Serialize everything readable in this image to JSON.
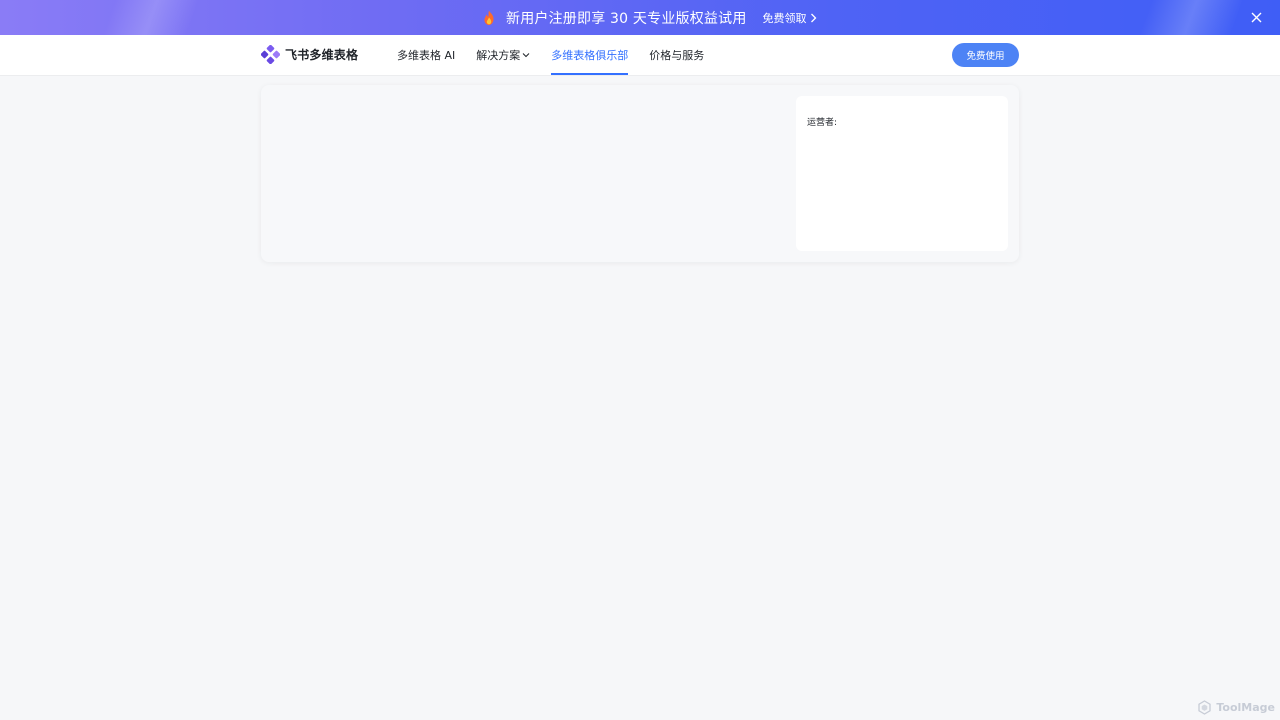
{
  "promo": {
    "icon": "fire-icon",
    "text": "新用户注册即享 30 天专业版权益试用",
    "cta_label": "免费领取",
    "cta_icon": "chevron-right-icon",
    "close_icon": "close-icon",
    "gradient_start": "#8a7cf6",
    "gradient_end": "#3f5ef6"
  },
  "nav": {
    "logo_text": "飞书多维表格",
    "logo_icon": "feishu-bitable-logo-icon",
    "links": [
      {
        "label": "多维表格 AI",
        "active": false
      },
      {
        "label": "解决方案",
        "active": false,
        "has_dropdown": true
      },
      {
        "label": "多维表格俱乐部",
        "active": true
      },
      {
        "label": "价格与服务",
        "active": false
      }
    ],
    "cta_label": "免费使用",
    "accent_color": "#3370ff",
    "cta_color": "#4d83f5"
  },
  "content": {
    "operator_label": "运营者:"
  },
  "watermark": {
    "text": "ToolMage",
    "icon": "toolmage-logo-icon"
  }
}
